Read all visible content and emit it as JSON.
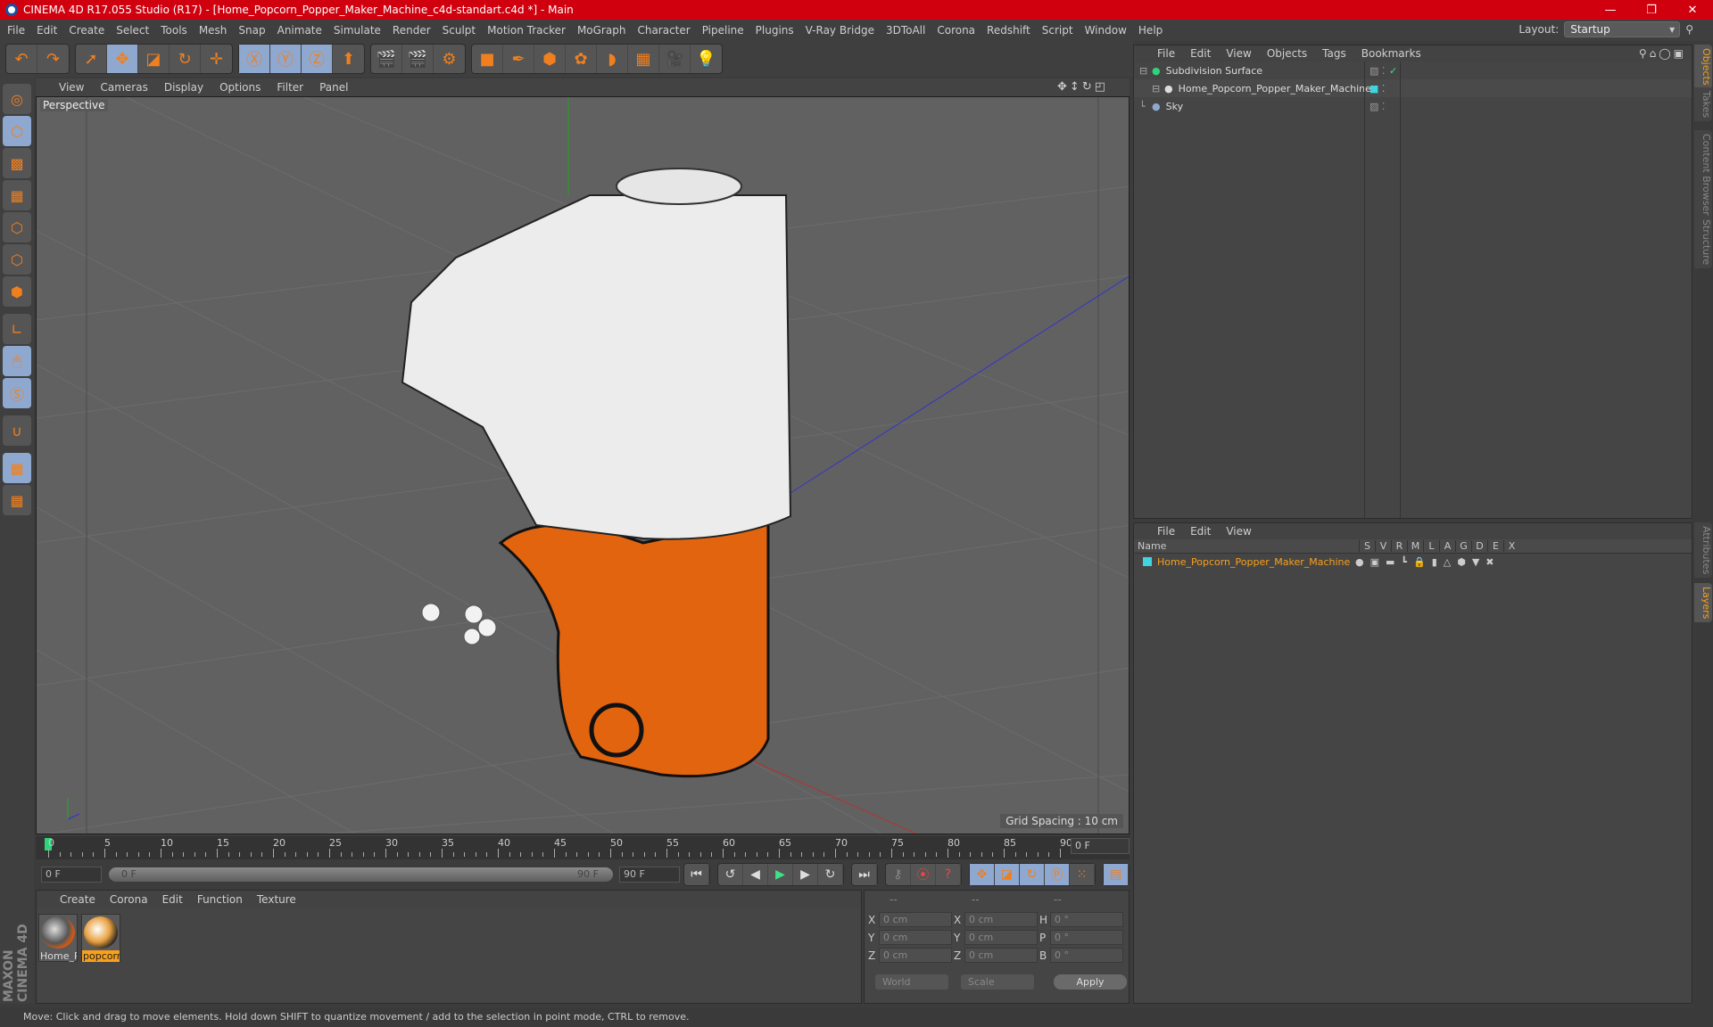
{
  "titlebar": {
    "title": "CINEMA 4D R17.055 Studio (R17) - [Home_Popcorn_Popper_Maker_Machine_c4d-standart.c4d *] - Main",
    "minimize": "—",
    "maximize": "❐",
    "close": "✕"
  },
  "menu": [
    "File",
    "Edit",
    "Create",
    "Select",
    "Tools",
    "Mesh",
    "Snap",
    "Animate",
    "Simulate",
    "Render",
    "Sculpt",
    "Motion Tracker",
    "MoGraph",
    "Character",
    "Pipeline",
    "Plugins",
    "V-Ray Bridge",
    "3DToAll",
    "Corona",
    "Redshift",
    "Script",
    "Window",
    "Help"
  ],
  "layout": {
    "label": "Layout:",
    "value": "Startup"
  },
  "toolbar": {
    "groups": [
      [
        {
          "name": "undo-icon",
          "g": "↶"
        },
        {
          "name": "redo-icon",
          "g": "↷"
        }
      ],
      [
        {
          "name": "select-icon",
          "g": "➚"
        },
        {
          "name": "move-icon",
          "g": "✥",
          "sel": true
        },
        {
          "name": "scale-icon",
          "g": "◪"
        },
        {
          "name": "rotate-icon",
          "g": "↻"
        },
        {
          "name": "transform-icon",
          "g": "✛"
        }
      ],
      [
        {
          "name": "x-axis-icon",
          "g": "Ⓧ",
          "sel": true
        },
        {
          "name": "y-axis-icon",
          "g": "Ⓨ",
          "sel": true
        },
        {
          "name": "z-axis-icon",
          "g": "Ⓩ",
          "sel": true
        },
        {
          "name": "coordinate-system-icon",
          "g": "⬆"
        }
      ],
      [
        {
          "name": "render-view-icon",
          "g": "🎬"
        },
        {
          "name": "render-picture-viewer-icon",
          "g": "🎬"
        },
        {
          "name": "render-settings-icon",
          "g": "⚙"
        }
      ],
      [
        {
          "name": "cube-icon",
          "g": "■"
        },
        {
          "name": "pen-icon",
          "g": "✒"
        },
        {
          "name": "subdivision-icon",
          "g": "⬢"
        },
        {
          "name": "cloner-icon",
          "g": "✿"
        },
        {
          "name": "deformer-icon",
          "g": "◗"
        },
        {
          "name": "floor-icon",
          "g": "▦"
        },
        {
          "name": "camera-icon",
          "g": "🎥"
        },
        {
          "name": "light-icon",
          "g": "💡"
        }
      ]
    ]
  },
  "leftbar": [
    {
      "name": "make-editable-icon",
      "g": "◎"
    },
    {
      "name": "model-mode-icon",
      "g": "⬡",
      "sel": true
    },
    {
      "name": "texture-mode-icon",
      "g": "▩"
    },
    {
      "name": "workplane-mode-icon",
      "g": "▦"
    },
    {
      "name": "points-mode-icon",
      "g": "⬡"
    },
    {
      "name": "edges-mode-icon",
      "g": "⬡"
    },
    {
      "name": "polygons-mode-icon",
      "g": "⬢"
    },
    {
      "name": "axis-mode-icon",
      "g": "∟"
    },
    {
      "name": "tweak-mode-icon",
      "g": "🖱",
      "sel": true
    },
    {
      "name": "solo-icon",
      "g": "Ⓢ",
      "sel": true
    },
    {
      "name": "snap-icon",
      "g": "∪"
    },
    {
      "name": "workplane-lock-icon",
      "g": "▦",
      "sel": true
    },
    {
      "name": "workplane-align-icon",
      "g": "▦"
    }
  ],
  "viewport": {
    "menu": [
      "View",
      "Cameras",
      "Display",
      "Options",
      "Filter",
      "Panel"
    ],
    "label": "Perspective",
    "grid_spacing": "Grid Spacing : 10 cm"
  },
  "timeline": {
    "ticks": [
      "0",
      "5",
      "10",
      "15",
      "20",
      "25",
      "30",
      "35",
      "40",
      "45",
      "50",
      "55",
      "60",
      "65",
      "70",
      "75",
      "80",
      "85",
      "90"
    ],
    "current_frame": "0 F"
  },
  "transport": {
    "start": "0 F",
    "range_start": "0 F",
    "range_end": "90 F",
    "end": "90 F"
  },
  "materials": {
    "menu": [
      "Create",
      "Corona",
      "Edit",
      "Function",
      "Texture"
    ],
    "items": [
      {
        "name": "Home_P",
        "selected": false
      },
      {
        "name": "popcorn",
        "selected": true
      }
    ]
  },
  "coords": {
    "headers": [
      "--",
      "--",
      "--"
    ],
    "rows": [
      {
        "a1": "X",
        "v1": "0 cm",
        "a2": "X",
        "v2": "0 cm",
        "a3": "H",
        "v3": "0 °"
      },
      {
        "a1": "Y",
        "v1": "0 cm",
        "a2": "Y",
        "v2": "0 cm",
        "a3": "P",
        "v3": "0 °"
      },
      {
        "a1": "Z",
        "v1": "0 cm",
        "a2": "Z",
        "v2": "0 cm",
        "a3": "B",
        "v3": "0 °"
      }
    ],
    "mode": "World",
    "type": "Scale",
    "apply": "Apply"
  },
  "objects": {
    "menu": [
      "File",
      "Edit",
      "View",
      "Objects",
      "Tags",
      "Bookmarks"
    ],
    "items": [
      {
        "name": "Subdivision Surface",
        "icon": "subdivision-icon",
        "indent": 0
      },
      {
        "name": "Home_Popcorn_Popper_Maker_Machine",
        "icon": "null-object-icon",
        "indent": 1
      },
      {
        "name": "Sky",
        "icon": "sky-icon",
        "indent": 0
      }
    ]
  },
  "layers": {
    "menu": [
      "File",
      "Edit",
      "View"
    ],
    "columns": [
      "Name",
      "S",
      "V",
      "R",
      "M",
      "L",
      "A",
      "G",
      "D",
      "E",
      "X"
    ],
    "items": [
      {
        "name": "Home_Popcorn_Popper_Maker_Machine",
        "color": "#3fd4e0"
      }
    ]
  },
  "sidetabs": {
    "top": [
      "Objects",
      "Takes",
      "Content Browser",
      "Structure"
    ],
    "bottom": [
      "Attributes",
      "Layers"
    ]
  },
  "brand": "MAXON CINEMA 4D",
  "status": "Move: Click and drag to move elements. Hold down SHIFT to quantize movement / add to the selection in point mode, CTRL to remove.",
  "colors": {
    "accent": "#f9a01b",
    "title_red": "#d0000f",
    "selected_blue": "#8fa8cf",
    "layer_cyan": "#3fd4e0"
  }
}
